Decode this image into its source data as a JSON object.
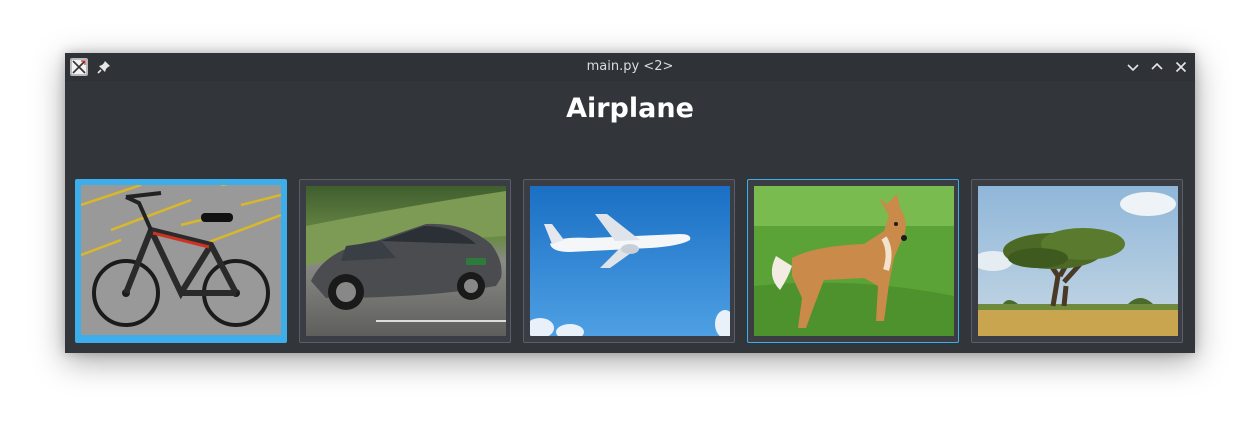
{
  "window": {
    "title": "main.py <2>"
  },
  "heading": "Airplane",
  "gallery": {
    "items": [
      {
        "subject": "bicycle",
        "selected": true,
        "hovered": false
      },
      {
        "subject": "car",
        "selected": false,
        "hovered": false
      },
      {
        "subject": "airplane",
        "selected": false,
        "hovered": false
      },
      {
        "subject": "dog",
        "selected": false,
        "hovered": true
      },
      {
        "subject": "tree",
        "selected": false,
        "hovered": false
      }
    ]
  },
  "colors": {
    "window_bg": "#32363b",
    "titlebar_bg": "#2f3337",
    "accent": "#3daee9",
    "heading_text": "#ffffff"
  },
  "icons": [
    "app-icon",
    "pin-icon",
    "minimize-icon",
    "maximize-icon",
    "close-icon"
  ]
}
